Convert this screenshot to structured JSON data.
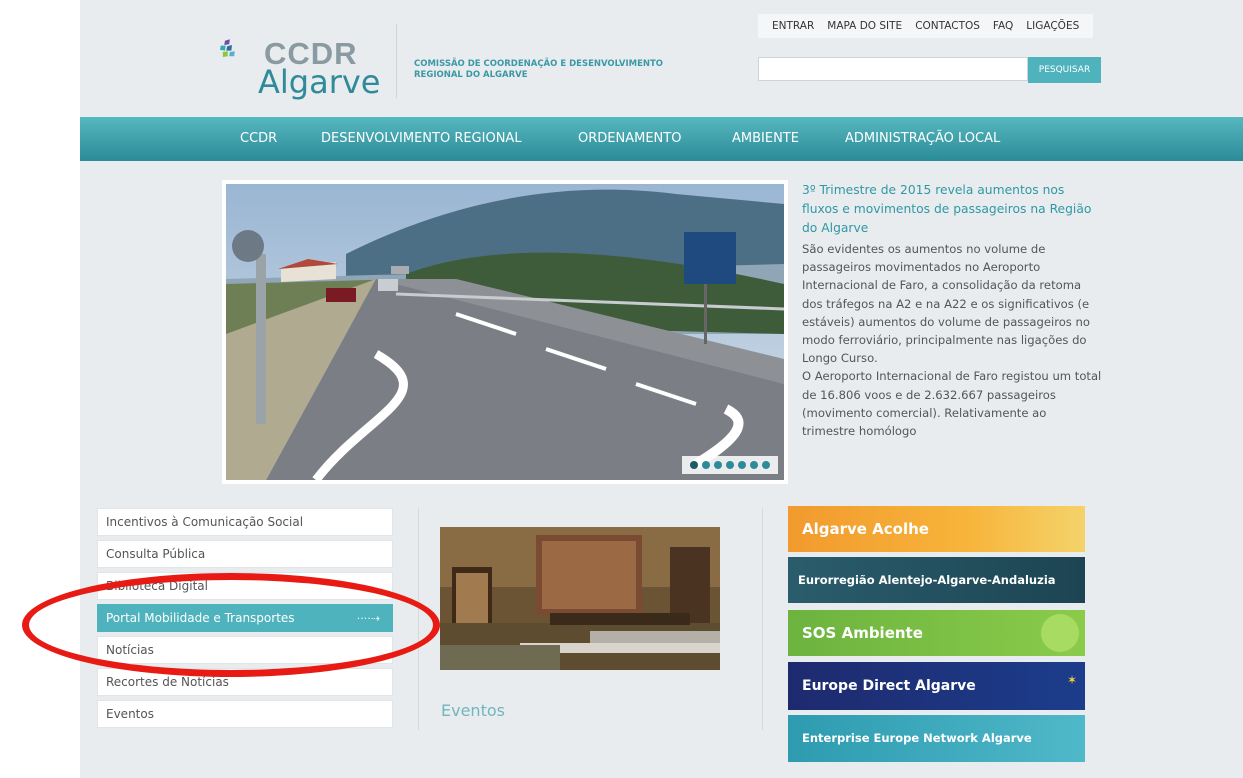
{
  "header": {
    "logo_line1": "CCDR",
    "logo_line2": "Algarve",
    "org_name_line1": "COMISSÃO DE COORDENAÇÃO E DESENVOLVIMENTO",
    "org_name_line2": "REGIONAL DO ALGARVE",
    "top_links": [
      "ENTRAR",
      "MAPA DO SITE",
      "CONTACTOS",
      "FAQ",
      "LIGAÇÕES"
    ],
    "search_placeholder": "",
    "search_button": "PESQUISAR"
  },
  "nav": {
    "items": [
      "CCDR",
      "DESENVOLVIMENTO REGIONAL",
      "ORDENAMENTO",
      "AMBIENTE",
      "ADMINISTRAÇÃO LOCAL"
    ]
  },
  "slider": {
    "slide_count": 7,
    "active_index": 0
  },
  "news": {
    "title": "3º Trimestre de 2015 revela aumentos nos fluxos e movimentos de passageiros na Região do Algarve",
    "body_p1": "São evidentes os aumentos no volume de passageiros movimentados no Aeroporto Internacional de Faro, a consolidação da retoma dos tráfegos na A2 e na A22 e os significativos (e estáveis) aumentos do volume de passageiros no modo ferroviário, principalmente nas ligações do Longo Curso.",
    "body_p2": "O Aeroporto Internacional de Faro registou um total de 16.806 voos e de 2.632.667 passageiros (movimento comercial). Relativamente ao trimestre homólogo"
  },
  "left_menu": {
    "items": [
      {
        "label": "Incentivos à Comunicação Social"
      },
      {
        "label": "Consulta Pública"
      },
      {
        "label": "Biblioteca Digital"
      },
      {
        "label": "Portal Mobilidade e Transportes"
      },
      {
        "label": "Notícias"
      },
      {
        "label": "Recortes de Notícias"
      },
      {
        "label": "Eventos"
      }
    ]
  },
  "events": {
    "title": "Eventos"
  },
  "banners": {
    "items": [
      {
        "label": "Algarve Acolhe",
        "color": "#f29a2e"
      },
      {
        "label": "Eurorregião Alentejo-Algarve-Andaluzia",
        "color": "#2a5d6c"
      },
      {
        "label": "SOS Ambiente",
        "color": "#6cb33f"
      },
      {
        "label": "Europe Direct Algarve",
        "color": "#1e2a6e"
      },
      {
        "label": "Enterprise Europe Network Algarve",
        "color": "#2e9bb0"
      }
    ]
  },
  "colors": {
    "accent": "#4fb3bd",
    "nav": "#3a9fa9",
    "highlight_oval": "#e81b14"
  }
}
